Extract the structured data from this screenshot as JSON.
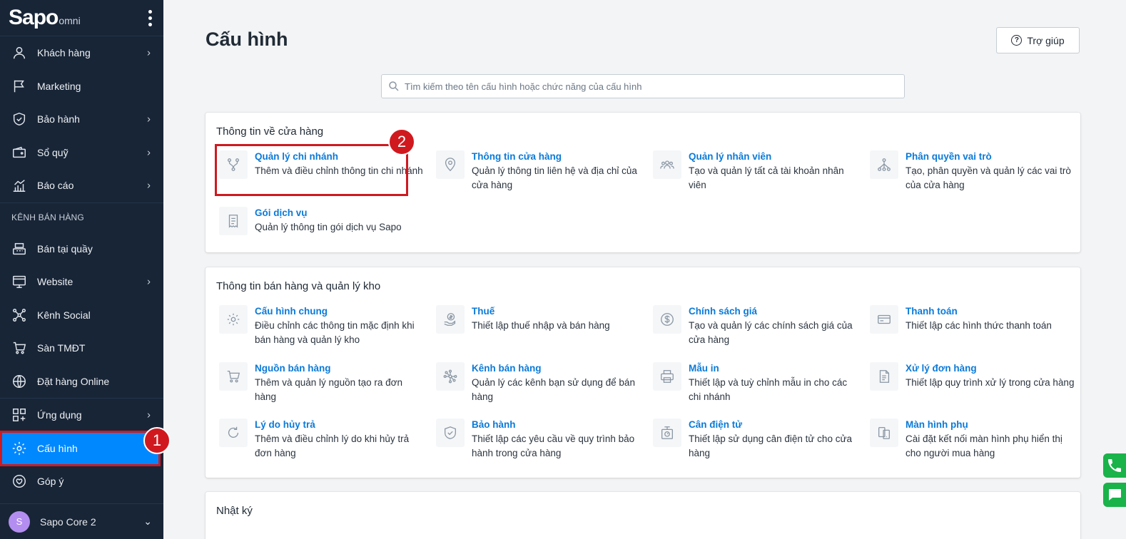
{
  "brand": {
    "logo_main": "Sapo",
    "logo_sub": "omni"
  },
  "sidebar": {
    "items": [
      {
        "label": "Khách hàng",
        "icon": "user-icon",
        "has_chevron": true
      },
      {
        "label": "Marketing",
        "icon": "flag-icon",
        "has_chevron": false
      },
      {
        "label": "Bảo hành",
        "icon": "shield-icon",
        "has_chevron": true
      },
      {
        "label": "Sổ quỹ",
        "icon": "wallet-icon",
        "has_chevron": true
      },
      {
        "label": "Báo cáo",
        "icon": "chart-icon",
        "has_chevron": true
      }
    ],
    "section_label": "KÊNH BÁN HÀNG",
    "channel_items": [
      {
        "label": "Bán tại quầy",
        "icon": "cash-register-icon",
        "has_chevron": false
      },
      {
        "label": "Website",
        "icon": "website-icon",
        "has_chevron": true
      },
      {
        "label": "Kênh Social",
        "icon": "social-icon",
        "has_chevron": false
      },
      {
        "label": "Sàn TMĐT",
        "icon": "cart-icon",
        "has_chevron": false
      },
      {
        "label": "Đặt hàng Online",
        "icon": "globe-icon",
        "has_chevron": false
      }
    ],
    "bottom_items": [
      {
        "label": "Ứng dụng",
        "icon": "apps-icon",
        "has_chevron": true
      },
      {
        "label": "Cấu hình",
        "icon": "gear-icon",
        "active": true
      },
      {
        "label": "Góp ý",
        "icon": "feedback-icon"
      }
    ],
    "user": {
      "avatar_letter": "S",
      "name": "Sapo Core 2"
    }
  },
  "annotations": {
    "step1": "1",
    "step2": "2"
  },
  "header": {
    "title": "Cấu hình",
    "help_label": "Trợ giúp"
  },
  "search": {
    "placeholder": "Tìm kiếm theo tên cấu hình hoặc chức năng của cấu hình"
  },
  "sections": [
    {
      "title": "Thông tin về cửa hàng",
      "items": [
        {
          "name": "Quản lý chi nhánh",
          "desc": "Thêm và điều chỉnh thông tin chi nhánh",
          "icon": "branch-icon"
        },
        {
          "name": "Thông tin cửa hàng",
          "desc": "Quản lý thông tin liên hệ và địa chỉ của cửa hàng",
          "icon": "location-pin-icon"
        },
        {
          "name": "Quản lý nhân viên",
          "desc": "Tạo và quản lý tất cả tài khoản nhân viên",
          "icon": "staff-icon"
        },
        {
          "name": "Phân quyền vai trò",
          "desc": "Tạo, phân quyền và quản lý các vai trò của cửa hàng",
          "icon": "hierarchy-icon"
        },
        {
          "name": "Gói dịch vụ",
          "desc": "Quản lý thông tin gói dịch vụ Sapo",
          "icon": "receipt-icon"
        }
      ]
    },
    {
      "title": "Thông tin bán hàng và quản lý kho",
      "items": [
        {
          "name": "Cấu hình chung",
          "desc": "Điều chỉnh các thông tin mặc định khi bán hàng và quản lý kho",
          "icon": "gear-icon"
        },
        {
          "name": "Thuế",
          "desc": "Thiết lập thuế nhập và bán hàng",
          "icon": "tax-icon"
        },
        {
          "name": "Chính sách giá",
          "desc": "Tạo và quản lý các chính sách giá của cửa hàng",
          "icon": "dollar-icon"
        },
        {
          "name": "Thanh toán",
          "desc": "Thiết lập các hình thức thanh toán",
          "icon": "credit-card-icon"
        },
        {
          "name": "Nguồn bán hàng",
          "desc": "Thêm và quản lý nguồn tạo ra đơn hàng",
          "icon": "cart-icon"
        },
        {
          "name": "Kênh bán hàng",
          "desc": "Quản lý các kênh bạn sử dụng để bán hàng",
          "icon": "network-icon"
        },
        {
          "name": "Mẫu in",
          "desc": "Thiết lập và tuỳ chỉnh mẫu in cho các chi nhánh",
          "icon": "printer-icon"
        },
        {
          "name": "Xử lý đơn hàng",
          "desc": "Thiết lập quy trình xử lý trong cửa hàng",
          "icon": "order-doc-icon"
        },
        {
          "name": "Lý do hủy trả",
          "desc": "Thêm và điều chỉnh lý do khi hủy trả đơn hàng",
          "icon": "refresh-icon"
        },
        {
          "name": "Bảo hành",
          "desc": "Thiết lập các yêu cầu về quy trình bảo hành trong cửa hàng",
          "icon": "shield-check-icon"
        },
        {
          "name": "Cân điện tử",
          "desc": "Thiết lập sử dụng cân điện tử cho cửa hàng",
          "icon": "scale-icon"
        },
        {
          "name": "Màn hình phụ",
          "desc": "Cài đặt kết nối màn hình phụ hiển thị cho người mua hàng",
          "icon": "second-screen-icon"
        }
      ]
    },
    {
      "title": "Nhật ký",
      "items": []
    }
  ],
  "colors": {
    "sidebar_bg": "#182537",
    "accent": "#0088ff",
    "link": "#0b7ad8",
    "highlight": "#d0191f",
    "float_green": "#19b34a"
  }
}
